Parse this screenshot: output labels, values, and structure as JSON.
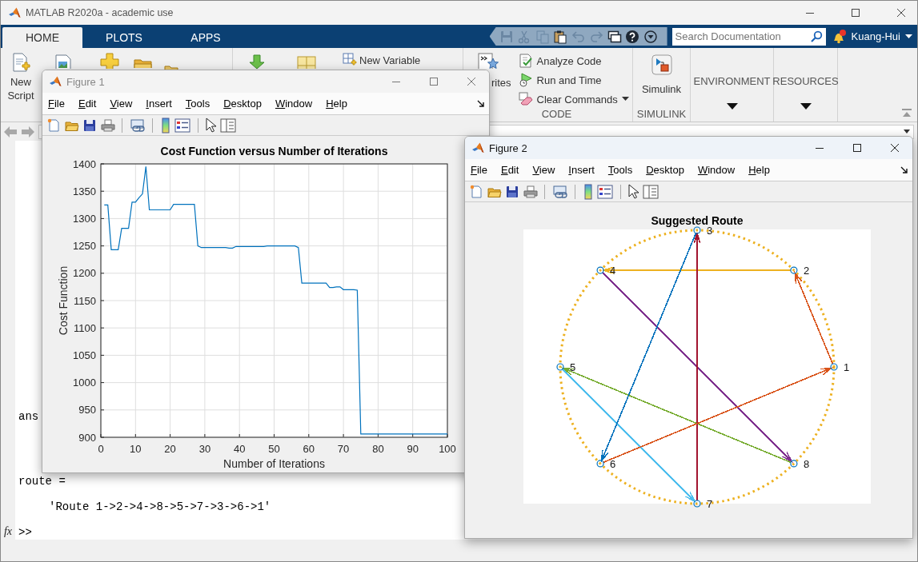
{
  "window": {
    "title": "MATLAB R2020a - academic use"
  },
  "ribbon_tabs": [
    {
      "label": "HOME",
      "selected": true
    },
    {
      "label": "PLOTS",
      "selected": false
    },
    {
      "label": "APPS",
      "selected": false
    }
  ],
  "quick_access": [
    {
      "kind": "save",
      "disabled": true
    },
    {
      "kind": "cut",
      "disabled": true
    },
    {
      "kind": "copy",
      "disabled": true
    },
    {
      "kind": "paste",
      "disabled": false
    },
    {
      "kind": "undo",
      "disabled": true
    },
    {
      "kind": "redo",
      "disabled": true
    },
    {
      "kind": "windows",
      "disabled": false
    },
    {
      "kind": "help",
      "disabled": false
    },
    {
      "kind": "more",
      "disabled": false
    }
  ],
  "search": {
    "placeholder": "Search Documentation"
  },
  "user": {
    "name": "Kuang-Hui"
  },
  "ribbon": {
    "new_script": "New Script",
    "new_variable": "New Variable",
    "favorites": "rites",
    "code_commands": [
      "Analyze Code",
      "Run and Time",
      "Clear Commands"
    ],
    "code_label": "CODE",
    "simulink": "Simulink",
    "simulink_label": "SIMULINK",
    "environment": "ENVIRONMENT",
    "resources": "RESOURCES"
  },
  "command_window": {
    "lines": [
      {
        "kind": "name",
        "text": "ans"
      },
      {
        "kind": "name",
        "text": "route ="
      },
      {
        "kind": "value",
        "text": "'Route 1->2->4->8->5->7->3->6->1'"
      }
    ],
    "function_hint": "fx",
    "prompt": ">>"
  },
  "figures": [
    {
      "title": "Figure 1",
      "active": false,
      "menu": [
        "File",
        "Edit",
        "View",
        "Insert",
        "Tools",
        "Desktop",
        "Window",
        "Help"
      ],
      "plot": {
        "kind": "line",
        "chart_data": {
          "type": "line",
          "title": "Cost Function versus Number of Iterations",
          "xlabel": "Number of Iterations",
          "ylabel": "Cost Function",
          "x": [
            1,
            2,
            3,
            4,
            5,
            6,
            7,
            8,
            9,
            10,
            11,
            12,
            13,
            14,
            15,
            16,
            17,
            18,
            19,
            20,
            21,
            22,
            23,
            24,
            25,
            26,
            27,
            28,
            29,
            30,
            31,
            32,
            33,
            34,
            35,
            36,
            37,
            38,
            39,
            40,
            41,
            42,
            43,
            44,
            45,
            46,
            47,
            48,
            49,
            50,
            51,
            52,
            53,
            54,
            55,
            56,
            57,
            58,
            59,
            60,
            61,
            62,
            63,
            64,
            65,
            66,
            67,
            68,
            69,
            70,
            71,
            72,
            73,
            74,
            75,
            76,
            77,
            78,
            79,
            80,
            81,
            82,
            83,
            84,
            85,
            86,
            87,
            88,
            89,
            90,
            91,
            92,
            93,
            94,
            95,
            96,
            97,
            98,
            99,
            100
          ],
          "series": [
            {
              "color": "#0072bd",
              "values": [
                1325,
                1325,
                1243,
                1243,
                1243,
                1282,
                1282,
                1282,
                1330,
                1330,
                1338,
                1345,
                1395,
                1316,
                1316,
                1316,
                1316,
                1316,
                1316,
                1316,
                1326,
                1326,
                1326,
                1326,
                1326,
                1326,
                1326,
                1250,
                1247,
                1247,
                1247,
                1247,
                1247,
                1247,
                1247,
                1247,
                1246,
                1246,
                1249,
                1249,
                1249,
                1249,
                1249,
                1249,
                1249,
                1249,
                1249,
                1250,
                1250,
                1250,
                1250,
                1250,
                1250,
                1250,
                1250,
                1250,
                1247,
                1182,
                1182,
                1182,
                1182,
                1182,
                1182,
                1182,
                1182,
                1174,
                1174,
                1175,
                1175,
                1170,
                1170,
                1170,
                1170,
                1169,
                906,
                906,
                906,
                906,
                906,
                906,
                906,
                906,
                906,
                906,
                906,
                906,
                906,
                906,
                906,
                906,
                906,
                906,
                906,
                906,
                906,
                906,
                906,
                906,
                906,
                906
              ]
            }
          ],
          "grid": true,
          "xlim": [
            0,
            100
          ],
          "ylim": [
            900,
            1400
          ],
          "xticks": [
            0,
            10,
            20,
            30,
            40,
            50,
            60,
            70,
            80,
            90,
            100
          ],
          "yticks": [
            900,
            950,
            1000,
            1050,
            1100,
            1150,
            1200,
            1250,
            1300,
            1350,
            1400
          ]
        }
      }
    },
    {
      "title": "Figure 2",
      "active": true,
      "menu": [
        "File",
        "Edit",
        "View",
        "Insert",
        "Tools",
        "Desktop",
        "Window",
        "Help"
      ],
      "plot": {
        "kind": "route",
        "title": "Suggested Route",
        "route_nodes": [
          {
            "label": "1",
            "color": "#d95319"
          },
          {
            "label": "2",
            "color": "#edb120"
          },
          {
            "label": "4",
            "color": "#7e2f8e"
          },
          {
            "label": "8",
            "color": "#77ac30"
          },
          {
            "label": "5",
            "color": "#4dbeee"
          },
          {
            "label": "7",
            "color": "#a2142f"
          },
          {
            "label": "3",
            "color": "#0072bd"
          },
          {
            "label": "6",
            "color": "#d95319"
          }
        ]
      }
    }
  ]
}
